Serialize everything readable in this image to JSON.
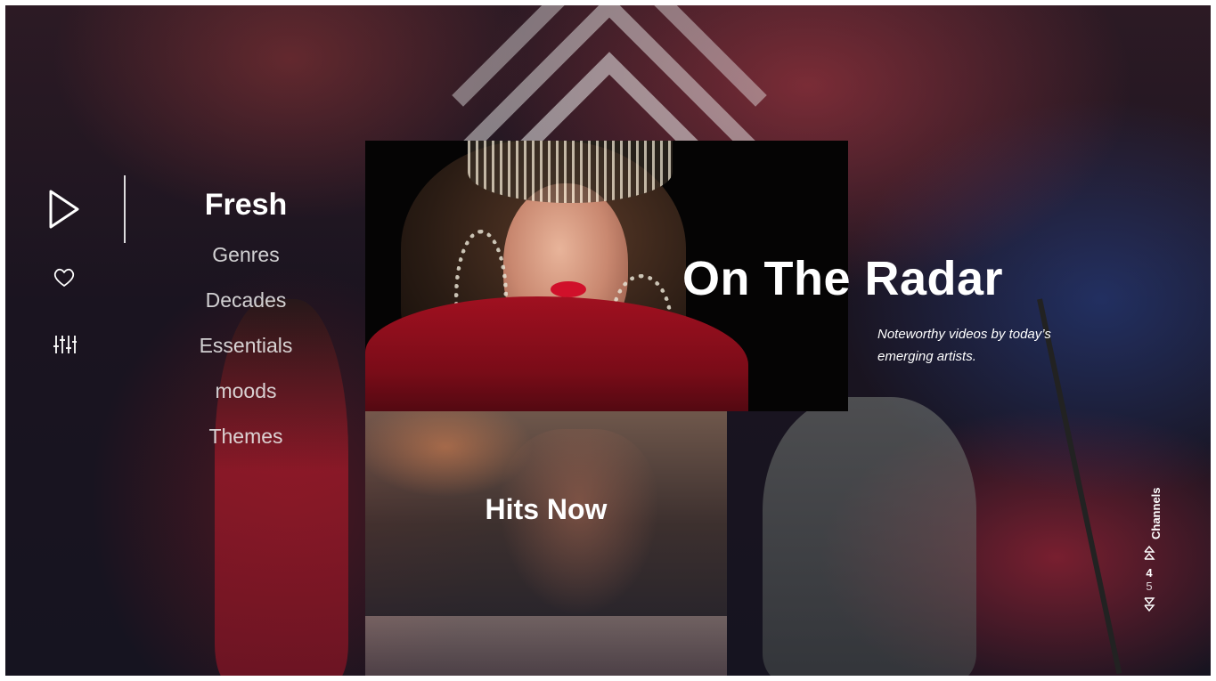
{
  "icons": {
    "play": "play-outline-icon",
    "favorites": "heart-outline-icon",
    "settings": "sliders-icon",
    "channel_up": "double-chevron-up-icon",
    "channel_down": "double-chevron-down-icon"
  },
  "nav": {
    "items": [
      {
        "label": "Fresh",
        "active": true
      },
      {
        "label": "Genres",
        "active": false
      },
      {
        "label": "Decades",
        "active": false
      },
      {
        "label": "Essentials",
        "active": false
      },
      {
        "label": "moods",
        "active": false
      },
      {
        "label": "Themes",
        "active": false
      }
    ]
  },
  "featured": {
    "title": "On The Radar",
    "description": "Noteworthy videos by today’s emerging artists."
  },
  "tiles": [
    {
      "title": "Hits Now"
    }
  ],
  "channels": {
    "label": "Channels",
    "current": "4",
    "next": "5"
  },
  "colors": {
    "text": "#ffffff",
    "accent_red": "#c8283a"
  }
}
